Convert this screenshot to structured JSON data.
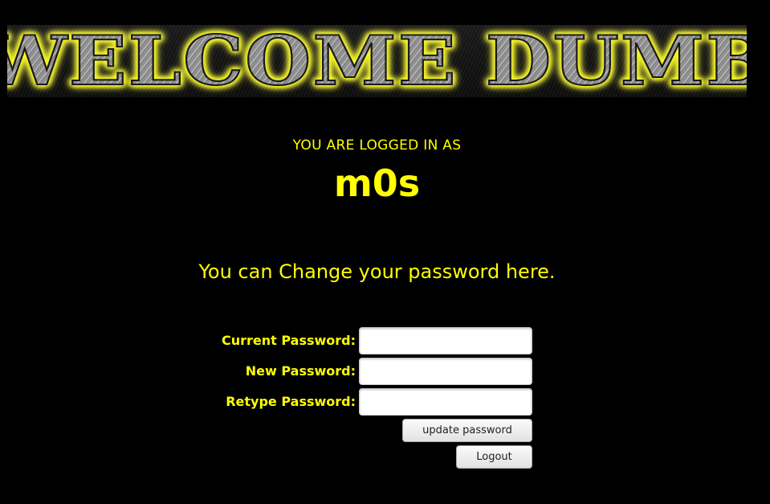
{
  "banner": {
    "text": "WELCOME DUMB"
  },
  "session": {
    "label": "YOU ARE LOGGED IN AS",
    "username": "m0s"
  },
  "prompt": "You can Change your password here.",
  "form": {
    "current_label": "Current Password:",
    "new_label": "New Password:",
    "retype_label": "Retype Password:",
    "current_value": "",
    "new_value": "",
    "retype_value": "",
    "submit_label": "update password",
    "logout_label": "Logout"
  },
  "colors": {
    "background": "#000000",
    "text_accent": "#ffff00",
    "banner_glow": "#ffff33"
  }
}
